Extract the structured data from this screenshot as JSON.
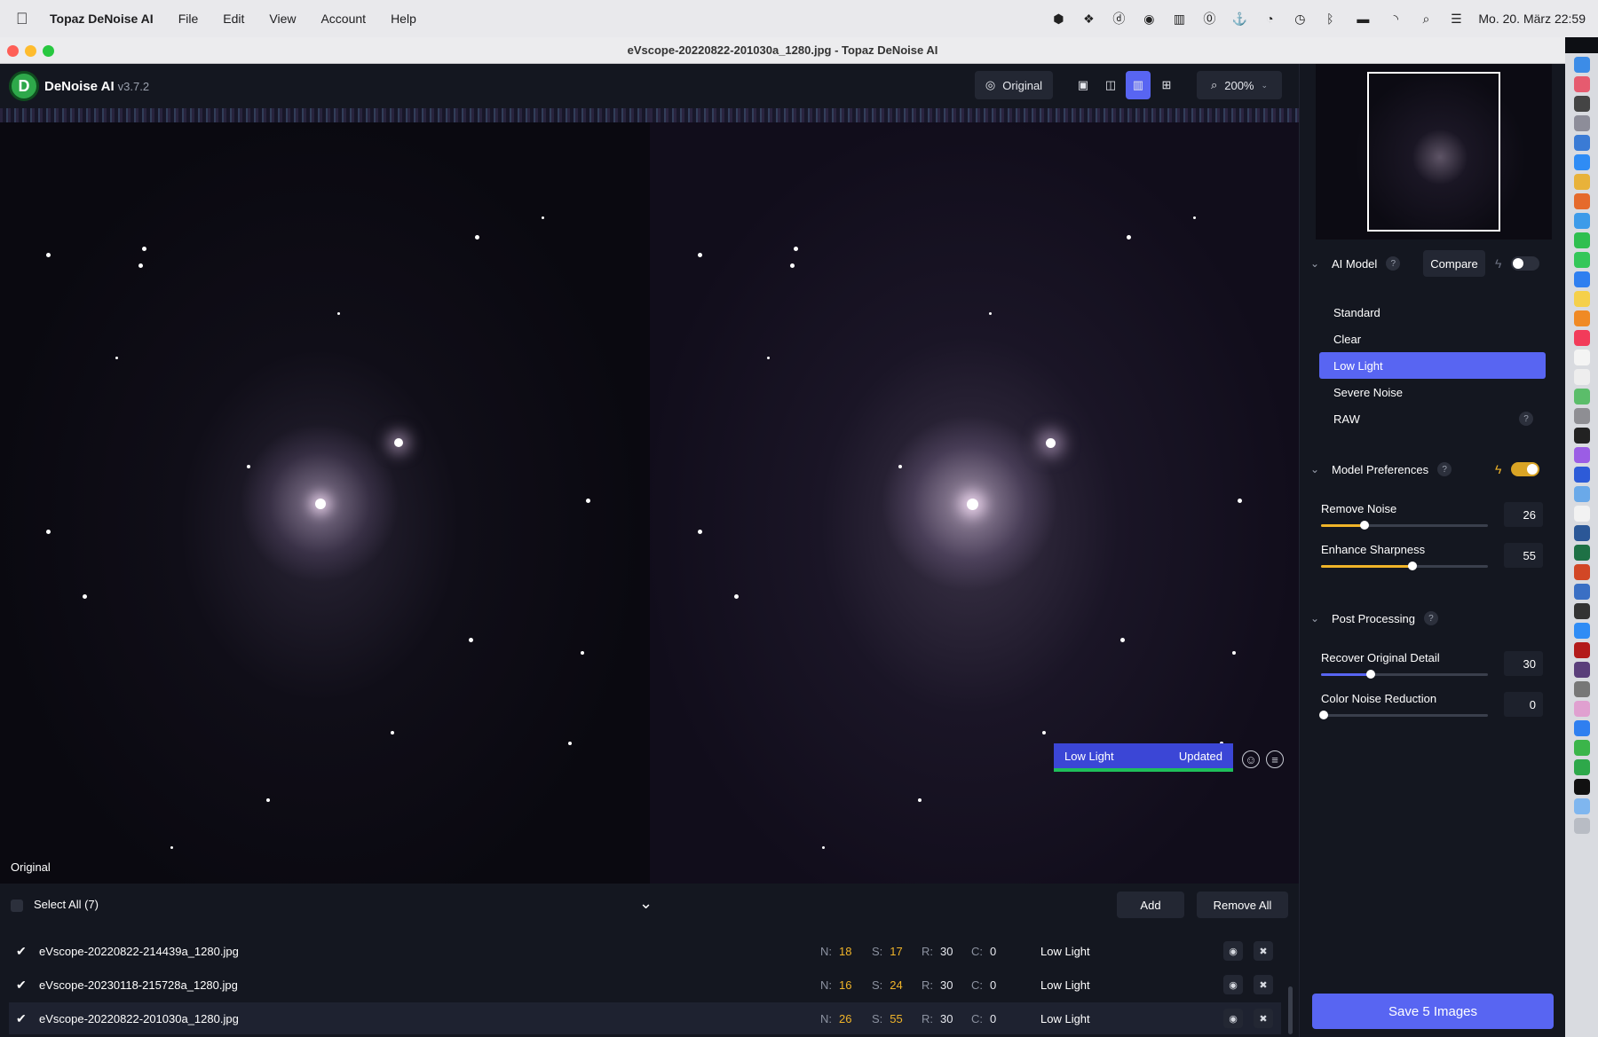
{
  "menubar": {
    "app_name": "Topaz DeNoise AI",
    "menus": [
      "File",
      "Edit",
      "View",
      "Account",
      "Help"
    ],
    "clock": "Mo. 20. März  22:59"
  },
  "window": {
    "title": "eVscope-20220822-201030a_1280.jpg - Topaz DeNoise AI"
  },
  "toolbar": {
    "logo_letter": "D",
    "app_name": "DeNoise AI",
    "version": "v3.7.2",
    "original_label": "Original",
    "zoom": "200%"
  },
  "preview": {
    "left_label": "Original",
    "status_model": "Low Light",
    "status_state": "Updated"
  },
  "filelist": {
    "select_all": "Select All (7)",
    "add_label": "Add",
    "remove_all_label": "Remove All",
    "rows": [
      {
        "name": "eVscope-20220822-214439a_1280.jpg",
        "n_label": "N:",
        "n": "18",
        "s_label": "S:",
        "s": "17",
        "r_label": "R:",
        "r": "30",
        "c_label": "C:",
        "c": "0",
        "model": "Low Light"
      },
      {
        "name": "eVscope-20230118-215728a_1280.jpg",
        "n_label": "N:",
        "n": "16",
        "s_label": "S:",
        "s": "24",
        "r_label": "R:",
        "r": "30",
        "c_label": "C:",
        "c": "0",
        "model": "Low Light"
      },
      {
        "name": "eVscope-20220822-201030a_1280.jpg",
        "n_label": "N:",
        "n": "26",
        "s_label": "S:",
        "s": "55",
        "r_label": "R:",
        "r": "30",
        "c_label": "C:",
        "c": "0",
        "model": "Low Light"
      }
    ]
  },
  "panel": {
    "ai_model_title": "AI Model",
    "compare_label": "Compare",
    "help_mark": "?",
    "models": [
      "Standard",
      "Clear",
      "Low Light",
      "Severe Noise",
      "RAW"
    ],
    "selected_model": "Low Light",
    "model_prefs_title": "Model Preferences",
    "remove_noise_label": "Remove Noise",
    "remove_noise_value": "26",
    "enhance_sharpness_label": "Enhance Sharpness",
    "enhance_sharpness_value": "55",
    "post_processing_title": "Post Processing",
    "recover_detail_label": "Recover Original Detail",
    "recover_detail_value": "30",
    "color_noise_label": "Color Noise Reduction",
    "color_noise_value": "0",
    "save_label": "Save 5 Images"
  },
  "colors": {
    "accent": "#5865f2",
    "slider_yellow": "#f0b429",
    "status_green": "#1fbf5a"
  }
}
